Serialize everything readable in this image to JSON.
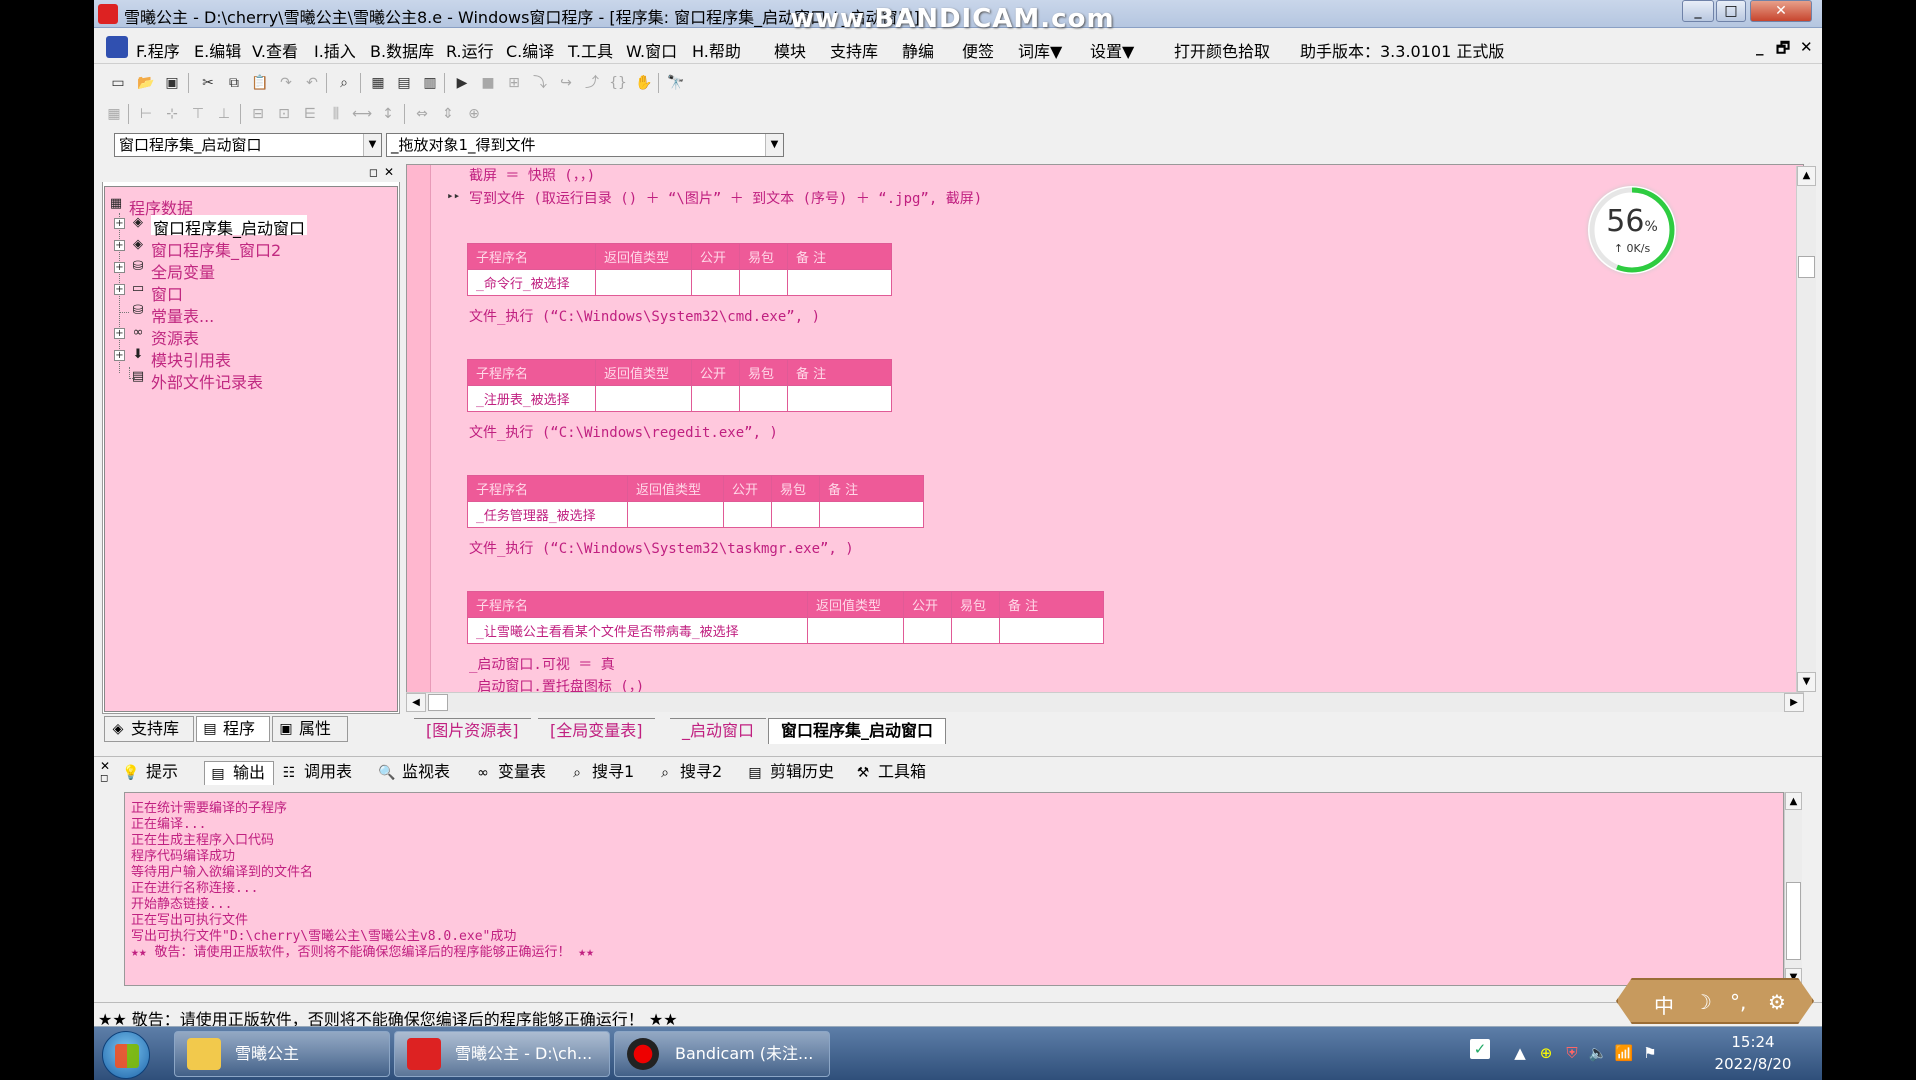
{
  "titlebar": {
    "title": "雪曦公主 - D:\\cherry\\雪曦公主\\雪曦公主8.e - Windows窗口程序 - [程序集: 窗口程序集_启动窗口 / _启动窗口]",
    "watermark": "www.BANDICAM.com",
    "buttons": [
      "_",
      "□",
      "✕"
    ]
  },
  "menu": {
    "items": [
      "F.程序",
      "E.编辑",
      "V.查看",
      "I.插入",
      "B.数据库",
      "R.运行",
      "C.编译",
      "T.工具",
      "W.窗口",
      "H.帮助",
      "模块",
      "支持库",
      "静编",
      "便签",
      "词库▼",
      "设置▼",
      "打开颜色拾取",
      "助手版本：3.3.0101 正式版"
    ],
    "mdi_buttons": [
      "_",
      "🗗",
      "✕"
    ]
  },
  "combos": {
    "left": "窗口程序集_启动窗口",
    "right": "_拖放对象1_得到文件"
  },
  "tree": {
    "root": "程序数据",
    "items": [
      "窗口程序集_启动窗口",
      "窗口程序集_窗口2",
      "全局变量",
      "窗口",
      "常量表...",
      "资源表",
      "模块引用表",
      "外部文件记录表"
    ]
  },
  "left_tabs": [
    "支持库",
    "程序",
    "属性"
  ],
  "editor": {
    "lines_top": [
      "截屏 ＝ 快照 (，，)",
      "写到文件 (取运行目录 () ＋ “\\图片” ＋ 到文本 (序号) ＋ “.jpg”, 截屏)"
    ],
    "table_headers": [
      "子程序名",
      "返回值类型",
      "公开",
      "易包",
      "备 注"
    ],
    "subs": [
      {
        "name": "_命令行_被选择",
        "body": "文件_执行 (“C:\\Windows\\System32\\cmd.exe”, )"
      },
      {
        "name": "_注册表_被选择",
        "body": "文件_执行 (“C:\\Windows\\regedit.exe”, )"
      },
      {
        "name": "_任务管理器_被选择",
        "body": "文件_执行 (“C:\\Windows\\System32\\taskmgr.exe”, )"
      },
      {
        "name": "_让雪曦公主看看某个文件是否带病毒_被选择",
        "body": "_启动窗口.可视 ＝ 真"
      }
    ],
    "last_line": "_启动窗口.置托盘图标 (，)"
  },
  "gauge": {
    "percent": "56",
    "unit": "%",
    "rate": "↑ 0K/s"
  },
  "editor_tabs": [
    "[图片资源表]",
    "[全局变量表]",
    "_启动窗口",
    "窗口程序集_启动窗口"
  ],
  "output_tabs": [
    "提示",
    "输出",
    "调用表",
    "监视表",
    "变量表",
    "搜寻1",
    "搜寻2",
    "剪辑历史",
    "工具箱"
  ],
  "output_lines": [
    "正在统计需要编译的子程序",
    "正在编译...",
    "正在生成主程序入口代码",
    "程序代码编译成功",
    "等待用户输入欲编译到的文件名",
    "正在进行名称连接...",
    "开始静态链接...",
    "正在写出可执行文件",
    "写出可执行文件\"D:\\cherry\\雪曦公主\\雪曦公主v8.0.exe\"成功",
    "★★ 敬告：请使用正版软件，否则将不能确保您编译后的程序能够正确运行！ ★★"
  ],
  "status": "★★ 敬告：请使用正版软件，否则将不能确保您编译后的程序能够正确运行！ ★★",
  "ime": [
    "中",
    "☽",
    "°,",
    "⚙"
  ],
  "taskbar": {
    "items": [
      "雪曦公主",
      "雪曦公主 - D:\\ch...",
      "Bandicam (未注..."
    ],
    "time": "15:24",
    "date": "2022/8/20"
  },
  "colors": {
    "editor_bg": "#ffc8dd",
    "header_pink": "#ee5a98",
    "code_pink": "#c02080"
  }
}
